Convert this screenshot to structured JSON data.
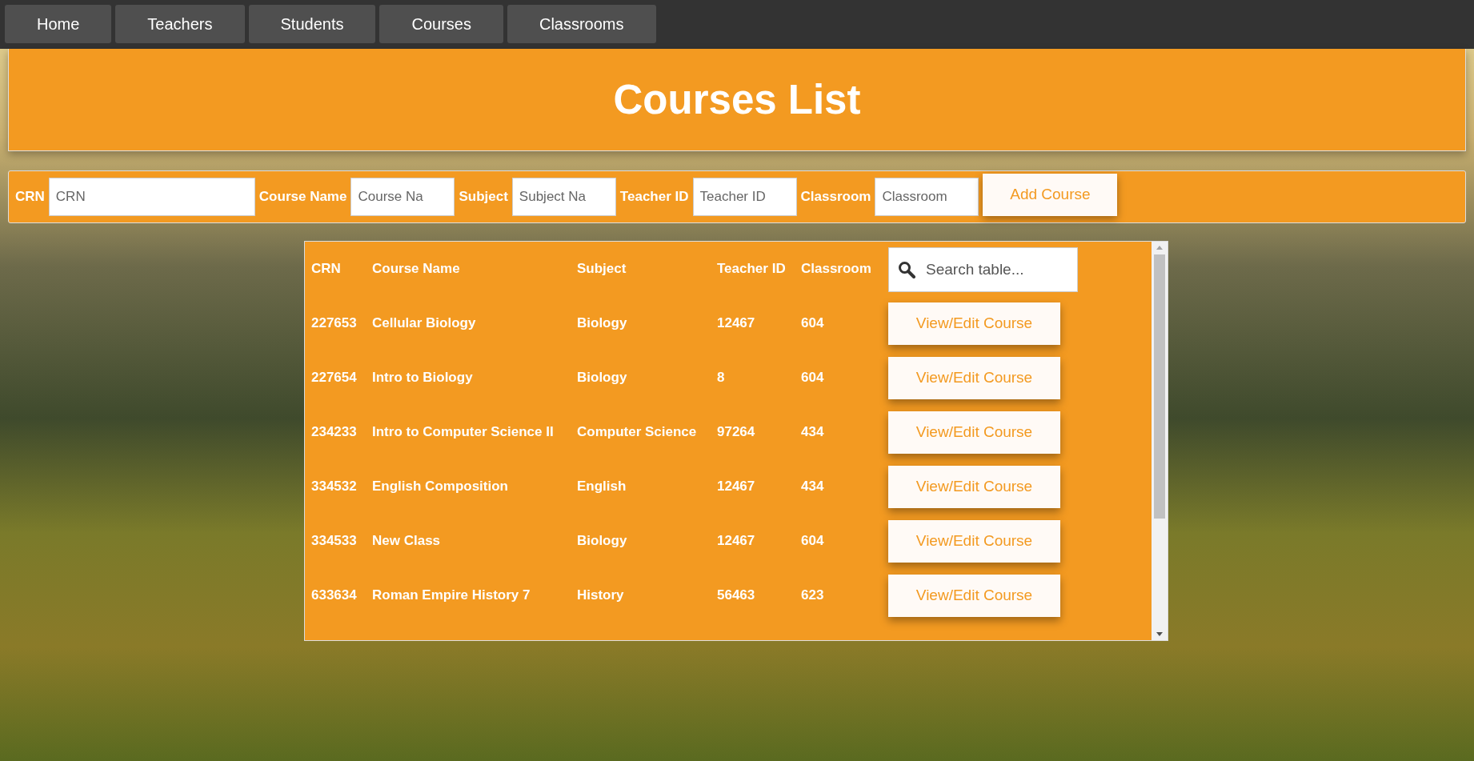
{
  "nav": {
    "items": [
      {
        "label": "Home"
      },
      {
        "label": "Teachers"
      },
      {
        "label": "Students"
      },
      {
        "label": "Courses"
      },
      {
        "label": "Classrooms"
      }
    ]
  },
  "header": {
    "title": "Courses List"
  },
  "form": {
    "fields": [
      {
        "label": "CRN",
        "placeholder": "CRN"
      },
      {
        "label": "Course Name",
        "placeholder": "Course Na"
      },
      {
        "label": "Subject",
        "placeholder": "Subject Na"
      },
      {
        "label": "Teacher ID",
        "placeholder": "Teacher ID"
      },
      {
        "label": "Classroom",
        "placeholder": "Classroom"
      }
    ],
    "submit": "Add Course"
  },
  "table": {
    "columns": [
      "CRN",
      "Course Name",
      "Subject",
      "Teacher ID",
      "Classroom"
    ],
    "search": {
      "placeholder": "Search table..."
    },
    "rows": [
      {
        "cells": [
          "227653",
          "Cellular Biology",
          "Biology",
          "12467",
          "604"
        ],
        "action": "View/Edit Course"
      },
      {
        "cells": [
          "227654",
          "Intro to Biology",
          "Biology",
          "8",
          "604"
        ],
        "action": "View/Edit Course"
      },
      {
        "cells": [
          "234233",
          "Intro to Computer Science II",
          "Computer Science",
          "97264",
          "434"
        ],
        "action": "View/Edit Course"
      },
      {
        "cells": [
          "334532",
          "English Composition",
          "English",
          "12467",
          "434"
        ],
        "action": "View/Edit Course"
      },
      {
        "cells": [
          "334533",
          "New Class",
          "Biology",
          "12467",
          "604"
        ],
        "action": "View/Edit Course"
      },
      {
        "cells": [
          "633634",
          "Roman Empire History 7",
          "History",
          "56463",
          "623"
        ],
        "action": "View/Edit Course"
      }
    ]
  }
}
